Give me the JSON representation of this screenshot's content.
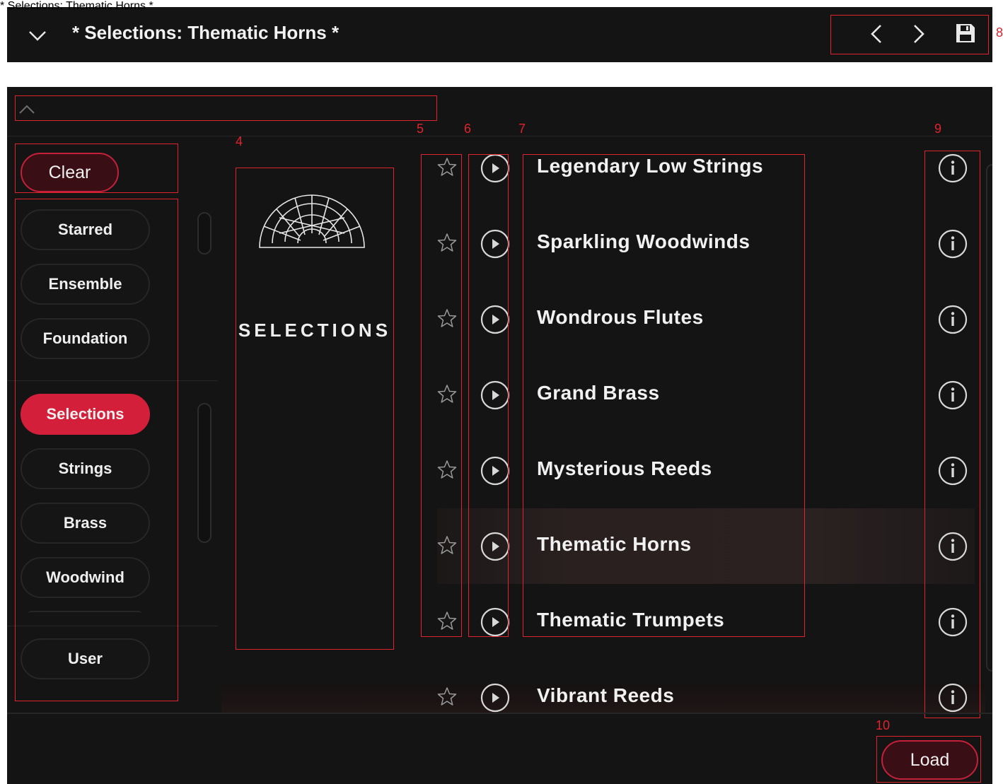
{
  "topbar": {
    "title": "* Selections: Thematic Horns *",
    "icons": [
      "chevron-down-icon",
      "chevron-left-icon",
      "chevron-right-icon",
      "save-icon"
    ]
  },
  "browser": {
    "header_title": "* Selections: Thematic Horns *",
    "clear_label": "Clear",
    "filters_top": [
      "Starred",
      "Ensemble",
      "Foundation"
    ],
    "filters_mid": [
      "Selections",
      "Strings",
      "Brass",
      "Woodwind"
    ],
    "filters_bottom": [
      "User"
    ],
    "active_filter": "Selections",
    "library_label": "SELECTIONS",
    "presets": [
      "Legendary Low Strings",
      "Sparkling Woodwinds",
      "Wondrous Flutes",
      "Grand Brass",
      "Mysterious Reeds",
      "Thematic Horns",
      "Thematic Trumpets",
      "Vibrant Reeds"
    ],
    "selected_preset": "Thematic Horns",
    "load_label": "Load"
  },
  "annotations": [
    "4",
    "5",
    "6",
    "7",
    "8",
    "9",
    "10"
  ],
  "colors": {
    "background": "#141414",
    "accent_red": "#d41f3a",
    "annotation_red": "#e0242d"
  }
}
